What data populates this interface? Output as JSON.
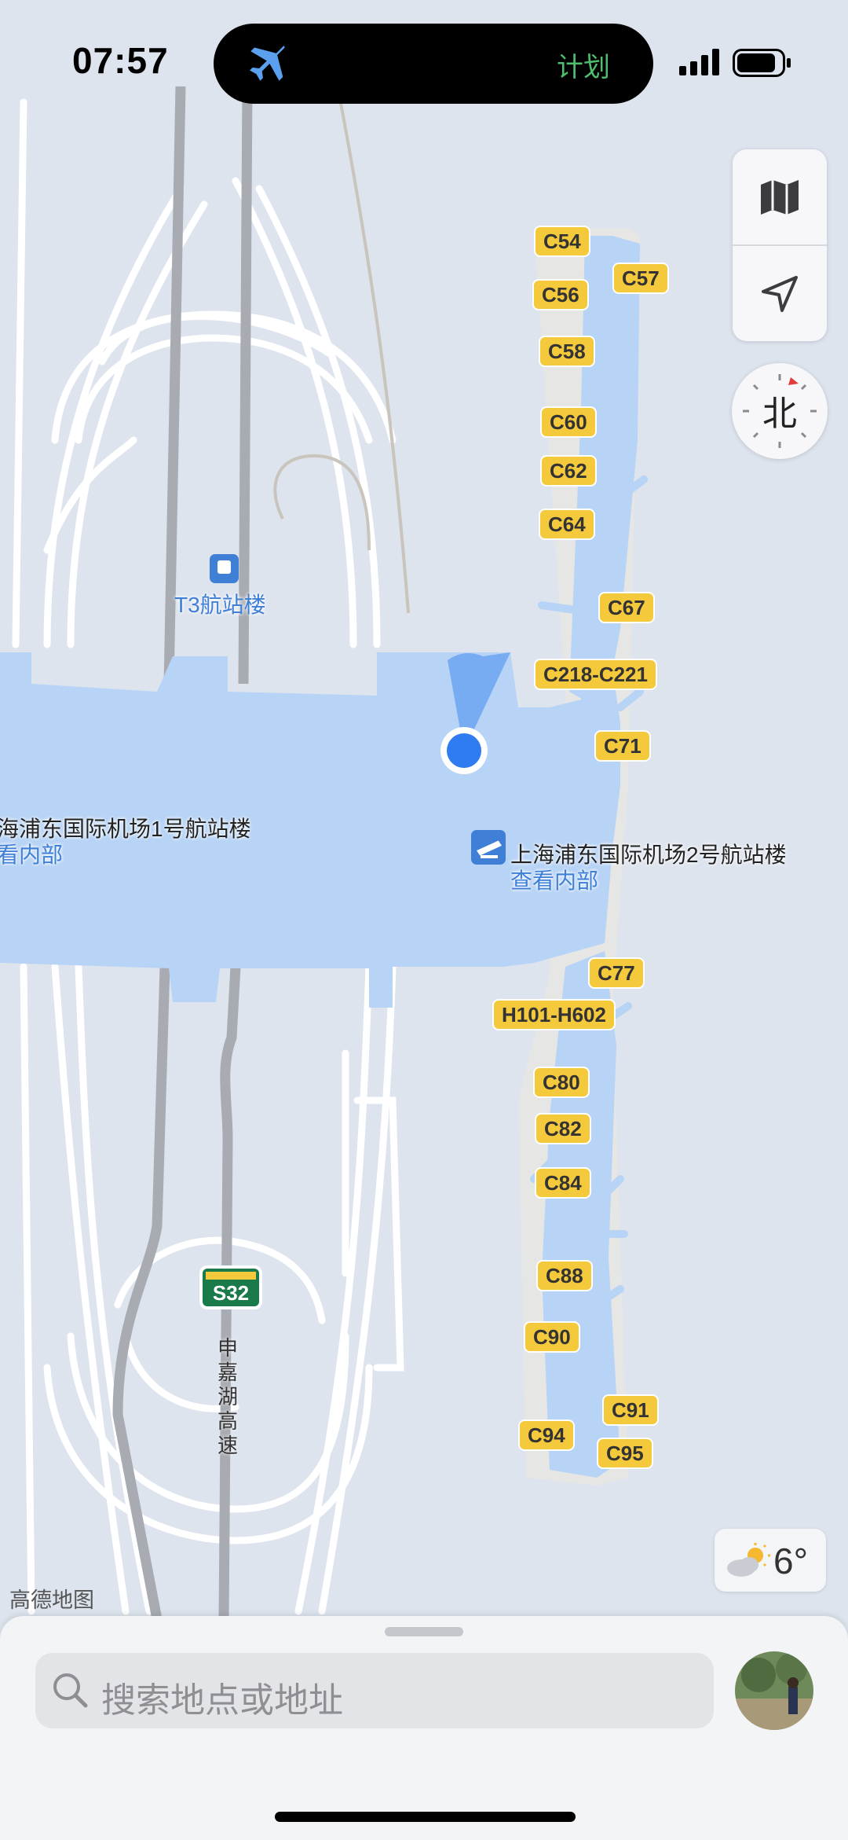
{
  "status_bar": {
    "time": "07:57",
    "activity": "计划",
    "accent": "#4fbf6d"
  },
  "map": {
    "poi_t3": "T3航站楼",
    "terminal1": {
      "name": "海浦东国际机场1号航站楼",
      "action": "看内部"
    },
    "terminal2": {
      "name": "上海浦东国际机场2号航站楼",
      "action": "查看内部"
    },
    "highway_shield": "S32",
    "highway_name": "申嘉湖高速",
    "gates": [
      "C54",
      "C57",
      "C56",
      "C58",
      "C60",
      "C62",
      "C64",
      "C67",
      "C218-C221",
      "C71",
      "C77",
      "H101-H602",
      "C80",
      "C82",
      "C84",
      "C88",
      "C90",
      "C91",
      "C94",
      "C95"
    ],
    "credit": "高德地图",
    "terminal_color": "#b7d3f5",
    "location_color": "#2f7bf0"
  },
  "controls": {
    "map_mode_icon": "map-icon",
    "locate_icon": "location-arrow-icon",
    "compass": "北"
  },
  "weather": {
    "temperature": "6°",
    "icon": "partly-cloudy-icon"
  },
  "search": {
    "placeholder": "搜索地点或地址"
  }
}
